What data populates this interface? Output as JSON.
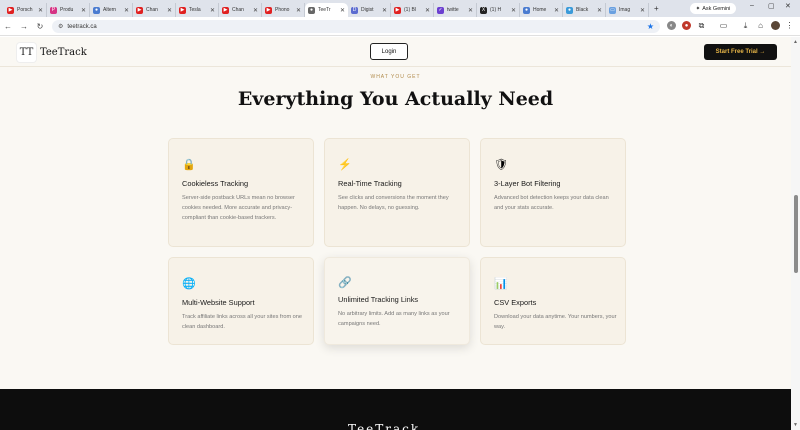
{
  "browser": {
    "tabs": [
      {
        "label": "Porsch",
        "color": "#e02020",
        "glyph": "▶"
      },
      {
        "label": "Produ",
        "color": "#d63384",
        "glyph": "P"
      },
      {
        "label": "Altern",
        "color": "#4a7bd0",
        "glyph": "●"
      },
      {
        "label": "Chan",
        "color": "#e02020",
        "glyph": "▶"
      },
      {
        "label": "Tesla",
        "color": "#e02020",
        "glyph": "▶"
      },
      {
        "label": "Chan",
        "color": "#e02020",
        "glyph": "▶"
      },
      {
        "label": "Phono",
        "color": "#e02020",
        "glyph": "▶"
      },
      {
        "label": "TeeTr",
        "color": "#666666",
        "glyph": "●",
        "active": true
      },
      {
        "label": "Digist",
        "color": "#5b6bd0",
        "glyph": "D"
      },
      {
        "label": "(1) Bl",
        "color": "#e02020",
        "glyph": "▶"
      },
      {
        "label": "twitte",
        "color": "#6b3fd0",
        "glyph": "✓"
      },
      {
        "label": "(1) H",
        "color": "#222222",
        "glyph": "X"
      },
      {
        "label": "Home",
        "color": "#4a7bd0",
        "glyph": "●"
      },
      {
        "label": "Black",
        "color": "#3a9ad9",
        "glyph": "●"
      },
      {
        "label": "Imag",
        "color": "#6aa0e0",
        "glyph": "▭"
      }
    ],
    "new_tab": "+",
    "ask_gemini": "Ask Gemini",
    "url": "teetrack.ca"
  },
  "header": {
    "logo_mark": "TT",
    "brand": "TeeTrack",
    "login_label": "Login",
    "trial_label": "Start Free Trial →"
  },
  "section": {
    "eyebrow": "WHAT YOU GET",
    "headline": "Everything You Actually Need"
  },
  "features": [
    {
      "icon": "🔒",
      "icon_name": "lock-icon",
      "title": "Cookieless Tracking",
      "desc": "Server-side postback URLs mean no browser cookies needed. More accurate and privacy-compliant than cookie-based trackers."
    },
    {
      "icon": "⚡",
      "icon_name": "lightning-icon",
      "title": "Real-Time Tracking",
      "desc": "See clicks and conversions the moment they happen. No delays, no guessing."
    },
    {
      "icon": "🛡",
      "icon_name": "shield-icon",
      "title": "3-Layer Bot Filtering",
      "desc": "Advanced bot detection keeps your data clean and your stats accurate."
    },
    {
      "icon": "🌐",
      "icon_name": "globe-icon",
      "title": "Multi-Website Support",
      "desc": "Track affiliate links across all your sites from one clean dashboard."
    },
    {
      "icon": "🔗",
      "icon_name": "link-icon",
      "title": "Unlimited Tracking Links",
      "desc": "No arbitrary limits. Add as many links as your campaigns need."
    },
    {
      "icon": "📊",
      "icon_name": "bar-chart-icon",
      "title": "CSV Exports",
      "desc": "Download your data anytime. Your numbers, your way."
    }
  ],
  "footer": {
    "logo": "TeeTrack"
  }
}
